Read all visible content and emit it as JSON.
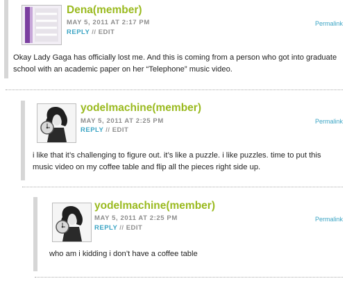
{
  "comments": [
    {
      "author": "Dena(member)",
      "date": "MAY 5, 2011 AT 2:17 PM",
      "reply": "REPLY",
      "separator": "//",
      "edit": "EDIT",
      "permalink": "Permalink",
      "text": "Okay Lady Gaga has officially lost me. And this is coming from a person who got into graduate school with an academic paper on her “Telephone” music video."
    },
    {
      "author": "yodelmachine(member)",
      "date": "MAY 5, 2011 AT 2:25 PM",
      "reply": "REPLY",
      "separator": "//",
      "edit": "EDIT",
      "permalink": "Permalink",
      "text": "i like that it’s challenging to figure out. it’s like a puzzle. i like puzzles. time to put this music video on my coffee table and flip all the pieces right side up."
    },
    {
      "author": "yodelmachine(member)",
      "date": "MAY 5, 2011 AT 2:25 PM",
      "reply": "REPLY",
      "separator": "//",
      "edit": "EDIT",
      "permalink": "Permalink",
      "text": "who am i kidding i don’t have a coffee table"
    }
  ]
}
